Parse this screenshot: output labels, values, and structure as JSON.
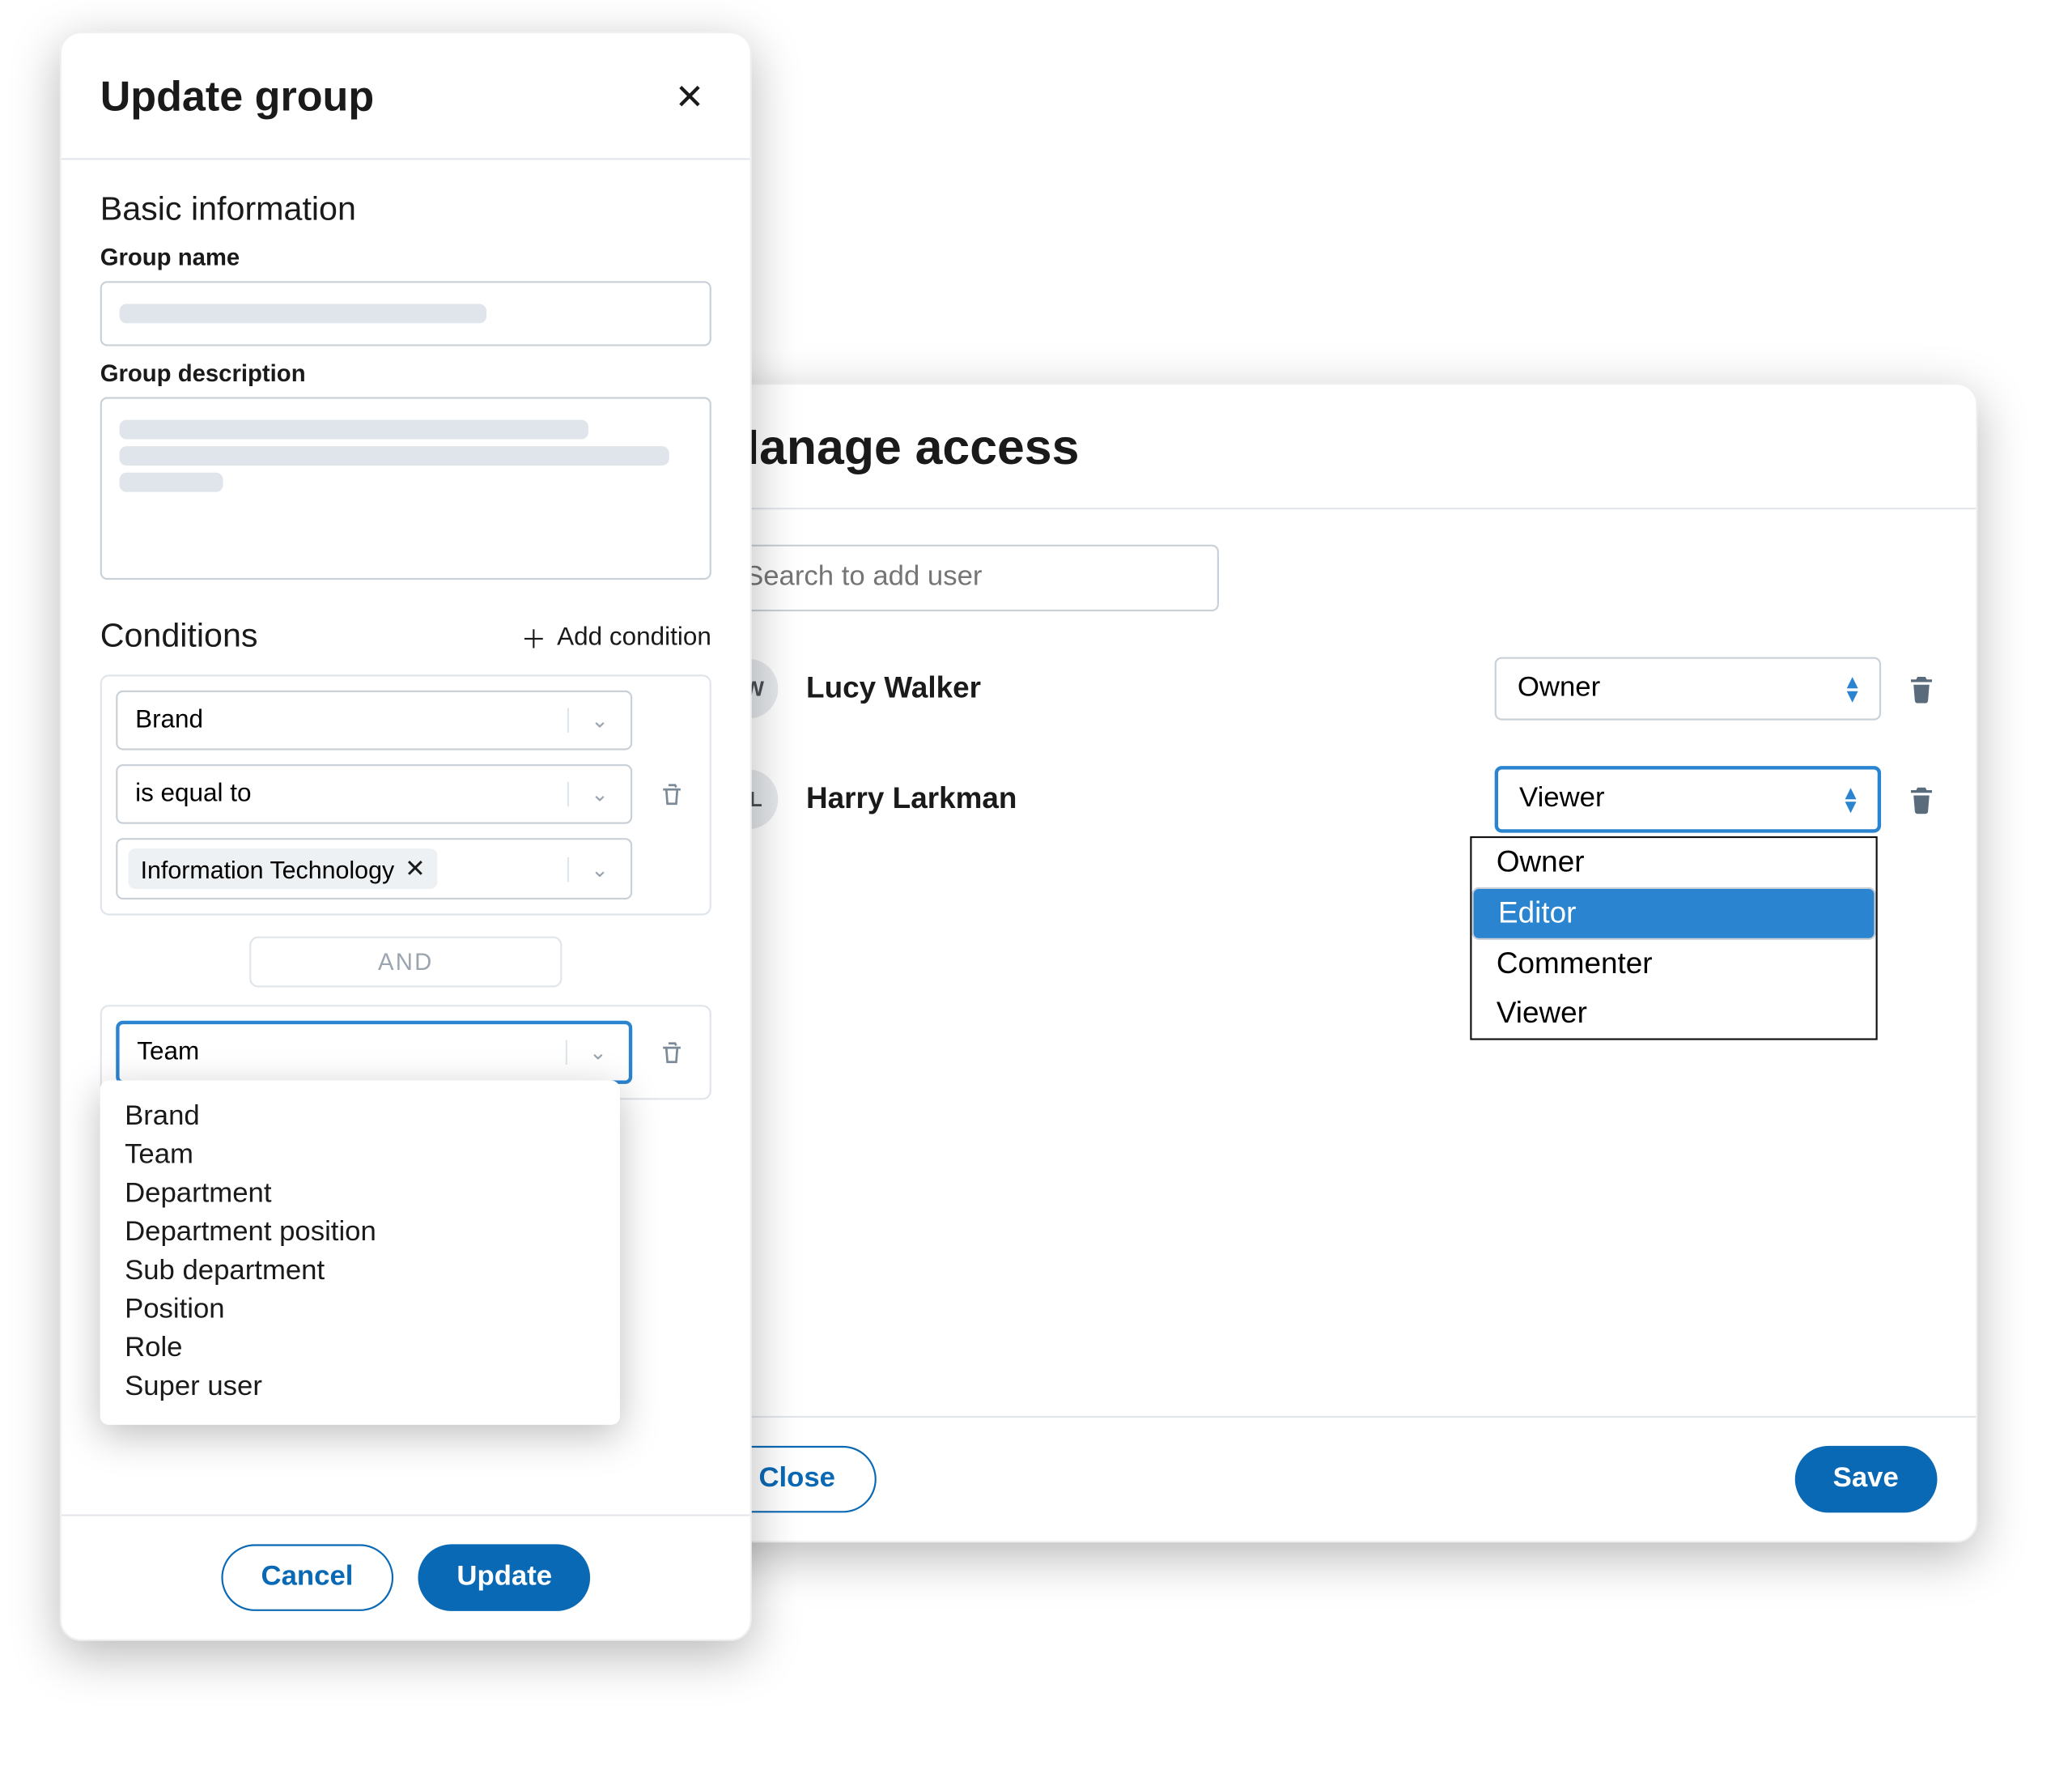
{
  "manage": {
    "title": "Manage access",
    "search_placeholder": "Search to add user",
    "users": [
      {
        "initials": "LW",
        "name": "Lucy Walker",
        "role": "Owner"
      },
      {
        "initials": "HL",
        "name": "Harry Larkman",
        "role": "Viewer"
      }
    ],
    "role_options": [
      "Owner",
      "Editor",
      "Commenter",
      "Viewer"
    ],
    "role_highlighted": "Editor",
    "close_label": "Close",
    "save_label": "Save"
  },
  "upgrp": {
    "title": "Update group",
    "basic_heading": "Basic information",
    "name_label": "Group name",
    "desc_label": "Group description",
    "cond_heading": "Conditions",
    "add_cond_label": "Add condition",
    "cond1": {
      "field": "Brand",
      "operator": "is equal to",
      "value": "Information Technology"
    },
    "and_label": "AND",
    "cond2_field_value": "Team",
    "field_options": [
      "Brand",
      "Team",
      "Department",
      "Department position",
      "Sub department",
      "Position",
      "Role",
      "Super user"
    ],
    "cancel_label": "Cancel",
    "update_label": "Update"
  }
}
